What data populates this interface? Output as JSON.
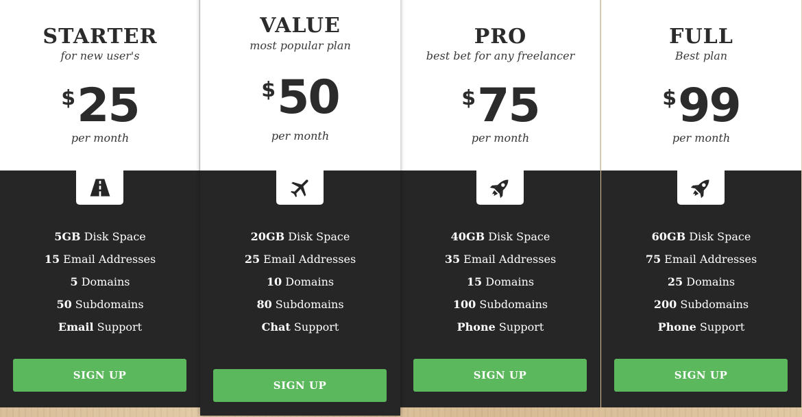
{
  "plans": [
    {
      "name": "STARTER",
      "tagline": "for new user's",
      "currency": "$",
      "price": "25",
      "period": "per month",
      "icon": "road-icon",
      "features": [
        {
          "value": "5GB",
          "label": " Disk Space"
        },
        {
          "value": "15",
          "label": " Email Addresses"
        },
        {
          "value": "5",
          "label": " Domains"
        },
        {
          "value": "50",
          "label": " Subdomains"
        },
        {
          "value": "Email",
          "label": " Support"
        }
      ],
      "button": "SIGN UP"
    },
    {
      "name": "VALUE",
      "tagline": "most popular plan",
      "currency": "$",
      "price": "50",
      "period": "per month",
      "icon": "plane-icon",
      "featured": true,
      "features": [
        {
          "value": "20GB",
          "label": " Disk Space"
        },
        {
          "value": "25",
          "label": " Email Addresses"
        },
        {
          "value": "10",
          "label": " Domains"
        },
        {
          "value": "80",
          "label": " Subdomains"
        },
        {
          "value": "Chat",
          "label": " Support"
        }
      ],
      "button": "SIGN UP"
    },
    {
      "name": "PRO",
      "tagline": "best bet for any freelancer",
      "currency": "$",
      "price": "75",
      "period": "per month",
      "icon": "rocket-icon",
      "features": [
        {
          "value": "40GB",
          "label": " Disk Space"
        },
        {
          "value": "35",
          "label": " Email Addresses"
        },
        {
          "value": "15",
          "label": " Domains"
        },
        {
          "value": "100",
          "label": " Subdomains"
        },
        {
          "value": "Phone",
          "label": " Support"
        }
      ],
      "button": "SIGN UP"
    },
    {
      "name": "FULL",
      "tagline": "Best plan",
      "currency": "$",
      "price": "99",
      "period": "per month",
      "icon": "rocket-icon",
      "features": [
        {
          "value": "60GB",
          "label": " Disk Space"
        },
        {
          "value": "75",
          "label": " Email Addresses"
        },
        {
          "value": "25",
          "label": " Domains"
        },
        {
          "value": "200",
          "label": " Subdomains"
        },
        {
          "value": "Phone",
          "label": " Support"
        }
      ],
      "button": "SIGN UP"
    }
  ],
  "colors": {
    "button": "#5cb85c",
    "dark_panel": "#262626",
    "header": "#ffffff"
  }
}
